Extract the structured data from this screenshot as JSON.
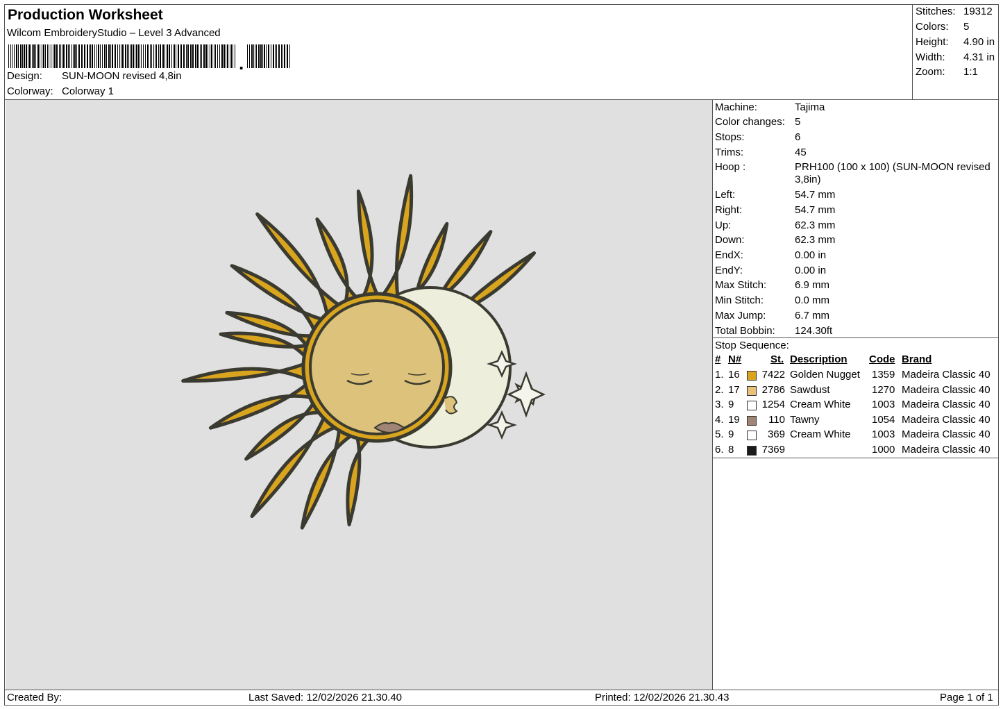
{
  "header": {
    "title": "Production Worksheet",
    "software": "Wilcom EmbroideryStudio – Level 3 Advanced",
    "design_label": "Design:",
    "design_value": "SUN-MOON revised 4,8in",
    "colorway_label": "Colorway:",
    "colorway_value": "Colorway 1"
  },
  "summary": {
    "stitches_label": "Stitches:",
    "stitches_value": "19312",
    "colors_label": "Colors:",
    "colors_value": "5",
    "height_label": "Height:",
    "height_value": "4.90 in",
    "width_label": "Width:",
    "width_value": "4.31 in",
    "zoom_label": "Zoom:",
    "zoom_value": "1:1"
  },
  "info": [
    {
      "label": "Machine:",
      "value": "Tajima"
    },
    {
      "label": "Color changes:",
      "value": "5"
    },
    {
      "label": "Stops:",
      "value": "6"
    },
    {
      "label": "Trims:",
      "value": "45"
    },
    {
      "label": "Hoop :",
      "value": "PRH100 (100 x 100) (SUN-MOON revised 3,8in)"
    },
    {
      "label": "Left:",
      "value": "54.7 mm"
    },
    {
      "label": "Right:",
      "value": "54.7 mm"
    },
    {
      "label": "Up:",
      "value": "62.3 mm"
    },
    {
      "label": "Down:",
      "value": "62.3 mm"
    },
    {
      "label": "EndX:",
      "value": "0.00 in"
    },
    {
      "label": "EndY:",
      "value": "0.00 in"
    },
    {
      "label": "Max Stitch:",
      "value": "6.9 mm"
    },
    {
      "label": "Min Stitch:",
      "value": "0.0 mm"
    },
    {
      "label": "Max Jump:",
      "value": "6.7 mm"
    },
    {
      "label": "Total Bobbin:",
      "value": "124.30ft"
    }
  ],
  "stop_sequence": {
    "label": "Stop Sequence:",
    "headers": {
      "num": "#",
      "n": "N#",
      "st": "St.",
      "description": "Description",
      "code": "Code",
      "brand": "Brand"
    },
    "rows": [
      {
        "num": "1.",
        "n": "16",
        "color": "#d9a51e",
        "st": "7422",
        "description": "Golden Nugget",
        "code": "1359",
        "brand": "Madeira Classic 40"
      },
      {
        "num": "2.",
        "n": "17",
        "color": "#e8c27a",
        "st": "2786",
        "description": "Sawdust",
        "code": "1270",
        "brand": "Madeira Classic 40"
      },
      {
        "num": "3.",
        "n": "9",
        "color": "#ffffff",
        "st": "1254",
        "description": "Cream White",
        "code": "1003",
        "brand": "Madeira Classic 40"
      },
      {
        "num": "4.",
        "n": "19",
        "color": "#a08474",
        "st": "110",
        "description": "Tawny",
        "code": "1054",
        "brand": "Madeira Classic 40"
      },
      {
        "num": "5.",
        "n": "9",
        "color": "#ffffff",
        "st": "369",
        "description": "Cream White",
        "code": "1003",
        "brand": "Madeira Classic 40"
      },
      {
        "num": "6.",
        "n": "8",
        "color": "#1a1a1a",
        "st": "7369",
        "description": "",
        "code": "1000",
        "brand": "Madeira Classic 40"
      }
    ]
  },
  "footer": {
    "created_by": "Created By:",
    "last_saved": "Last Saved: 12/02/2026 21.30.40",
    "printed": "Printed: 12/02/2026 21.30.43",
    "page": "Page 1 of 1"
  },
  "colors": {
    "canvas_bg": "#e0e0e0",
    "sun_gold": "#d9a51e",
    "sun_face": "#dcc27a",
    "moon_cream": "#eeeedd",
    "outline": "#3a3a30",
    "lips": "#a08474"
  }
}
